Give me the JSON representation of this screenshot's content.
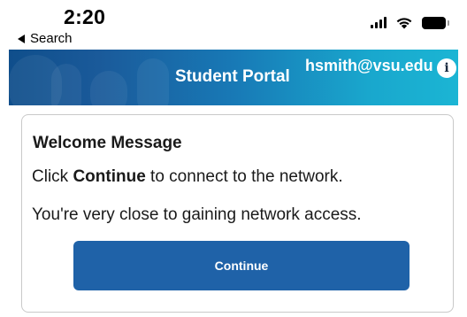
{
  "status_bar": {
    "time": "2:20",
    "back_label": "Search",
    "icons": [
      "signal-bars-icon",
      "wifi-icon",
      "battery-icon"
    ]
  },
  "header": {
    "title": "Student Portal",
    "user_email": "hsmith@vsu.edu",
    "info_icon_glyph": "i",
    "colors": {
      "gradient_start": "#0f4e8b",
      "gradient_end": "#1bb5d4"
    }
  },
  "card": {
    "title": "Welcome Message",
    "line1_prefix": "Click ",
    "line1_bold": "Continue",
    "line1_suffix": " to connect to the network.",
    "line2": "You're very close to gaining network access.",
    "continue_label": "Continue",
    "button_color": "#1f62a8"
  }
}
